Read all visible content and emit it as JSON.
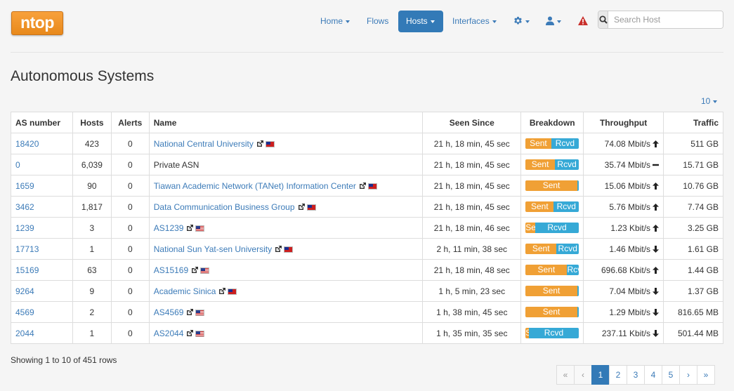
{
  "brand": {
    "logo_text": "ntop"
  },
  "nav": {
    "home": "Home",
    "flows": "Flows",
    "hosts": "Hosts",
    "interfaces": "Interfaces"
  },
  "search": {
    "placeholder": "Search Host"
  },
  "page": {
    "title": "Autonomous Systems",
    "per_page": "10"
  },
  "table": {
    "headers": [
      "AS number",
      "Hosts",
      "Alerts",
      "Name",
      "Seen Since",
      "Breakdown",
      "Throughput",
      "Traffic"
    ],
    "rows": [
      {
        "asn": "18420",
        "asn_link": true,
        "hosts": "423",
        "alerts": "0",
        "name": "National Central University",
        "name_link": true,
        "flag": "tw",
        "seen": "21 h, 18 min, 45 sec",
        "sent_pct": 48,
        "sent_label": "Sent",
        "rcvd_label": "Rcvd",
        "throughput": "74.08 Mbit/s",
        "trend": "up",
        "traffic": "511 GB"
      },
      {
        "asn": "0",
        "asn_link": true,
        "hosts": "6,039",
        "alerts": "0",
        "name": "Private ASN",
        "name_link": false,
        "flag": "",
        "seen": "21 h, 18 min, 45 sec",
        "sent_pct": 55,
        "sent_label": "Sent",
        "rcvd_label": "Rcvd",
        "throughput": "35.74 Mbit/s",
        "trend": "flat",
        "traffic": "15.71 GB"
      },
      {
        "asn": "1659",
        "asn_link": true,
        "hosts": "90",
        "alerts": "0",
        "name": "Tiawan Academic Network (TANet) Information Center",
        "name_link": true,
        "flag": "tw",
        "seen": "21 h, 18 min, 45 sec",
        "sent_pct": 97,
        "sent_label": "Sent",
        "rcvd_label": "",
        "throughput": "15.06 Mbit/s",
        "trend": "up",
        "traffic": "10.76 GB"
      },
      {
        "asn": "3462",
        "asn_link": true,
        "hosts": "1,817",
        "alerts": "0",
        "name": "Data Communication Business Group",
        "name_link": true,
        "flag": "tw",
        "seen": "21 h, 18 min, 45 sec",
        "sent_pct": 53,
        "sent_label": "Sent",
        "rcvd_label": "Rcvd",
        "throughput": "5.76 Mbit/s",
        "trend": "up",
        "traffic": "7.74 GB"
      },
      {
        "asn": "1239",
        "asn_link": true,
        "hosts": "3",
        "alerts": "0",
        "name": "AS1239",
        "name_link": true,
        "flag": "us",
        "seen": "21 h, 18 min, 46 sec",
        "sent_pct": 18,
        "sent_label": "Se",
        "rcvd_label": "Rcvd",
        "throughput": "1.23 Kbit/s",
        "trend": "up",
        "traffic": "3.25 GB"
      },
      {
        "asn": "17713",
        "asn_link": true,
        "hosts": "1",
        "alerts": "0",
        "name": "National Sun Yat-sen University",
        "name_link": true,
        "flag": "tw",
        "seen": "2 h, 11 min, 38 sec",
        "sent_pct": 58,
        "sent_label": "Sent",
        "rcvd_label": "Rcvd",
        "throughput": "1.46 Mbit/s",
        "trend": "down",
        "traffic": "1.61 GB"
      },
      {
        "asn": "15169",
        "asn_link": true,
        "hosts": "63",
        "alerts": "0",
        "name": "AS15169",
        "name_link": true,
        "flag": "us",
        "seen": "21 h, 18 min, 48 sec",
        "sent_pct": 78,
        "sent_label": "Sent",
        "rcvd_label": "Rcv",
        "throughput": "696.68 Kbit/s",
        "trend": "up",
        "traffic": "1.44 GB"
      },
      {
        "asn": "9264",
        "asn_link": true,
        "hosts": "9",
        "alerts": "0",
        "name": "Academic Sinica",
        "name_link": true,
        "flag": "tw",
        "seen": "1 h, 5 min, 23 sec",
        "sent_pct": 97,
        "sent_label": "Sent",
        "rcvd_label": "",
        "throughput": "7.04 Mbit/s",
        "trend": "down",
        "traffic": "1.37 GB"
      },
      {
        "asn": "4569",
        "asn_link": true,
        "hosts": "2",
        "alerts": "0",
        "name": "AS4569",
        "name_link": true,
        "flag": "us",
        "seen": "1 h, 38 min, 45 sec",
        "sent_pct": 97,
        "sent_label": "Sent",
        "rcvd_label": "",
        "throughput": "1.29 Mbit/s",
        "trend": "down",
        "traffic": "816.65 MB"
      },
      {
        "asn": "2044",
        "asn_link": true,
        "hosts": "1",
        "alerts": "0",
        "name": "AS2044",
        "name_link": true,
        "flag": "us",
        "seen": "1 h, 35 min, 35 sec",
        "sent_pct": 6,
        "sent_label": "S",
        "rcvd_label": "Rcvd",
        "throughput": "237.11 Kbit/s",
        "trend": "down",
        "traffic": "501.44 MB"
      }
    ]
  },
  "footer": {
    "showing": "Showing 1 to 10 of 451 rows",
    "pages": [
      "«",
      "‹",
      "1",
      "2",
      "3",
      "4",
      "5",
      "›",
      "»"
    ],
    "active_page": "1"
  },
  "colors": {
    "accent": "#337ab7",
    "link": "#3c7bb8",
    "sent": "#f0a035",
    "rcvd": "#36a9d6",
    "alert": "#c9302c"
  }
}
